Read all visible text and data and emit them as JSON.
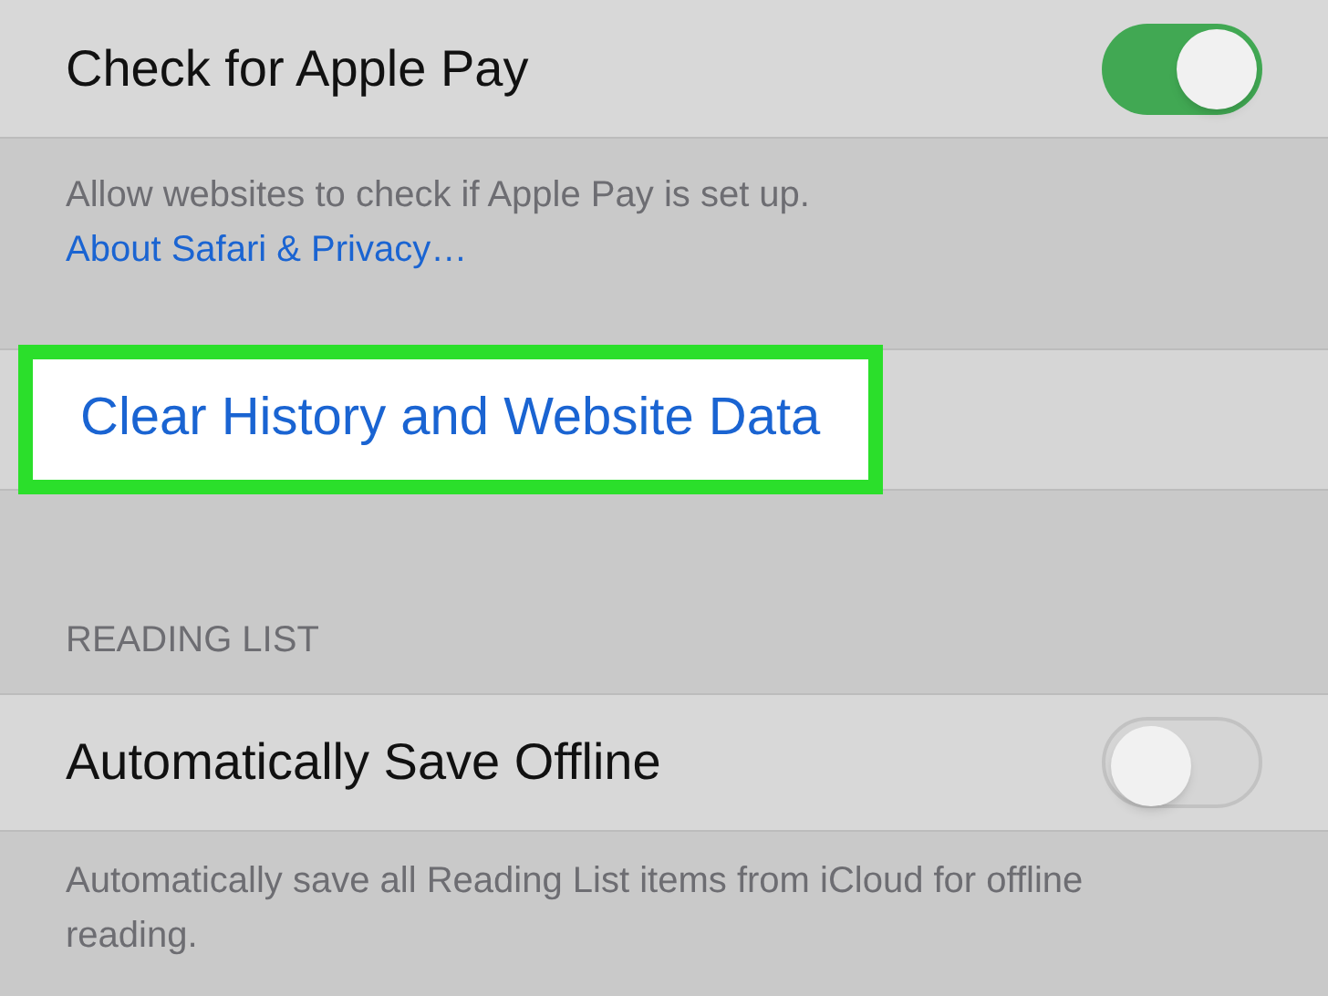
{
  "rows_top": {
    "label": "Check for Apple Pay",
    "on": true
  },
  "apple_pay_footer": {
    "text": "Allow websites to check if Apple Pay is set up.",
    "link": "About Safari & Privacy…"
  },
  "clear_row": {
    "label": "Clear History and Website Data",
    "highlighted": true
  },
  "reading_list": {
    "header": "READING LIST",
    "label": "Automatically Save Offline",
    "on": false,
    "footer": "Automatically save all Reading List items from iCloud for offline reading."
  }
}
